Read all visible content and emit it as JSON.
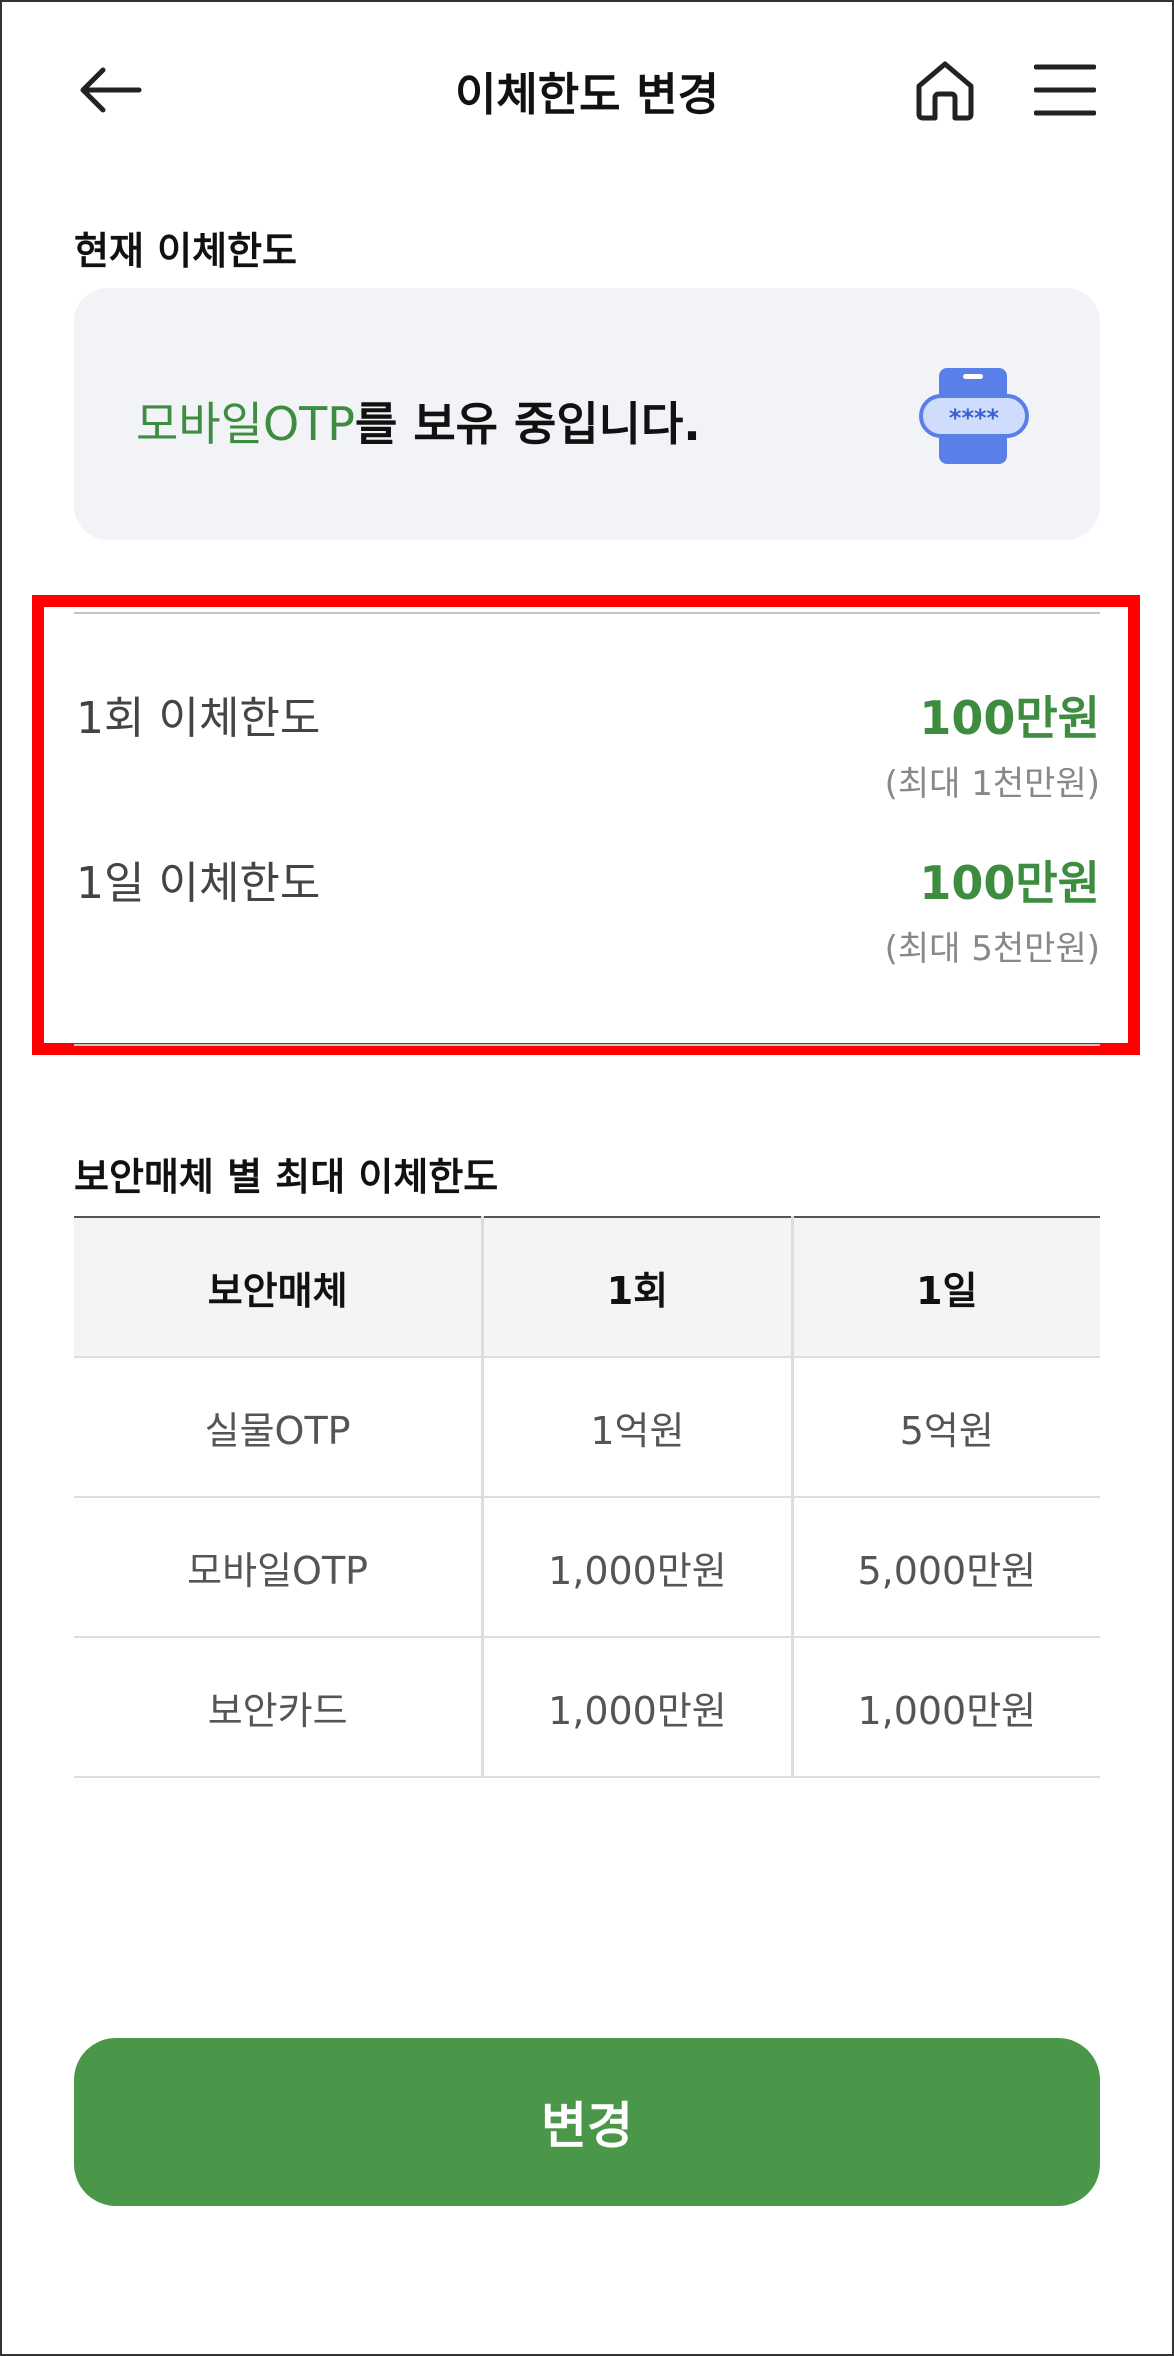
{
  "header": {
    "title": "이체한도 변경"
  },
  "current": {
    "section_title": "현재 이체한도",
    "card": {
      "highlight": "모바일OTP",
      "rest": "를 보유 중입니다."
    }
  },
  "limits": [
    {
      "label": "1회 이체한도",
      "value": "100만원",
      "max": "(최대 1천만원)"
    },
    {
      "label": "1일 이체한도",
      "value": "100만원",
      "max": "(최대 5천만원)"
    }
  ],
  "media_table": {
    "title": "보안매체 별 최대 이체한도",
    "headers": [
      "보안매체",
      "1회",
      "1일"
    ],
    "rows": [
      [
        "실물OTP",
        "1억원",
        "5억원"
      ],
      [
        "모바일OTP",
        "1,000만원",
        "5,000만원"
      ],
      [
        "보안카드",
        "1,000만원",
        "1,000만원"
      ]
    ]
  },
  "button": {
    "label": "변경"
  },
  "colors": {
    "accent": "#3d8c3f",
    "button": "#4a974a",
    "highlight_box": "#ff0000",
    "card_bg": "#f2f3f7"
  },
  "icons": {
    "back": "arrow-left-icon",
    "home": "home-icon",
    "menu": "hamburger-menu-icon",
    "otp": "mobile-otp-icon"
  }
}
